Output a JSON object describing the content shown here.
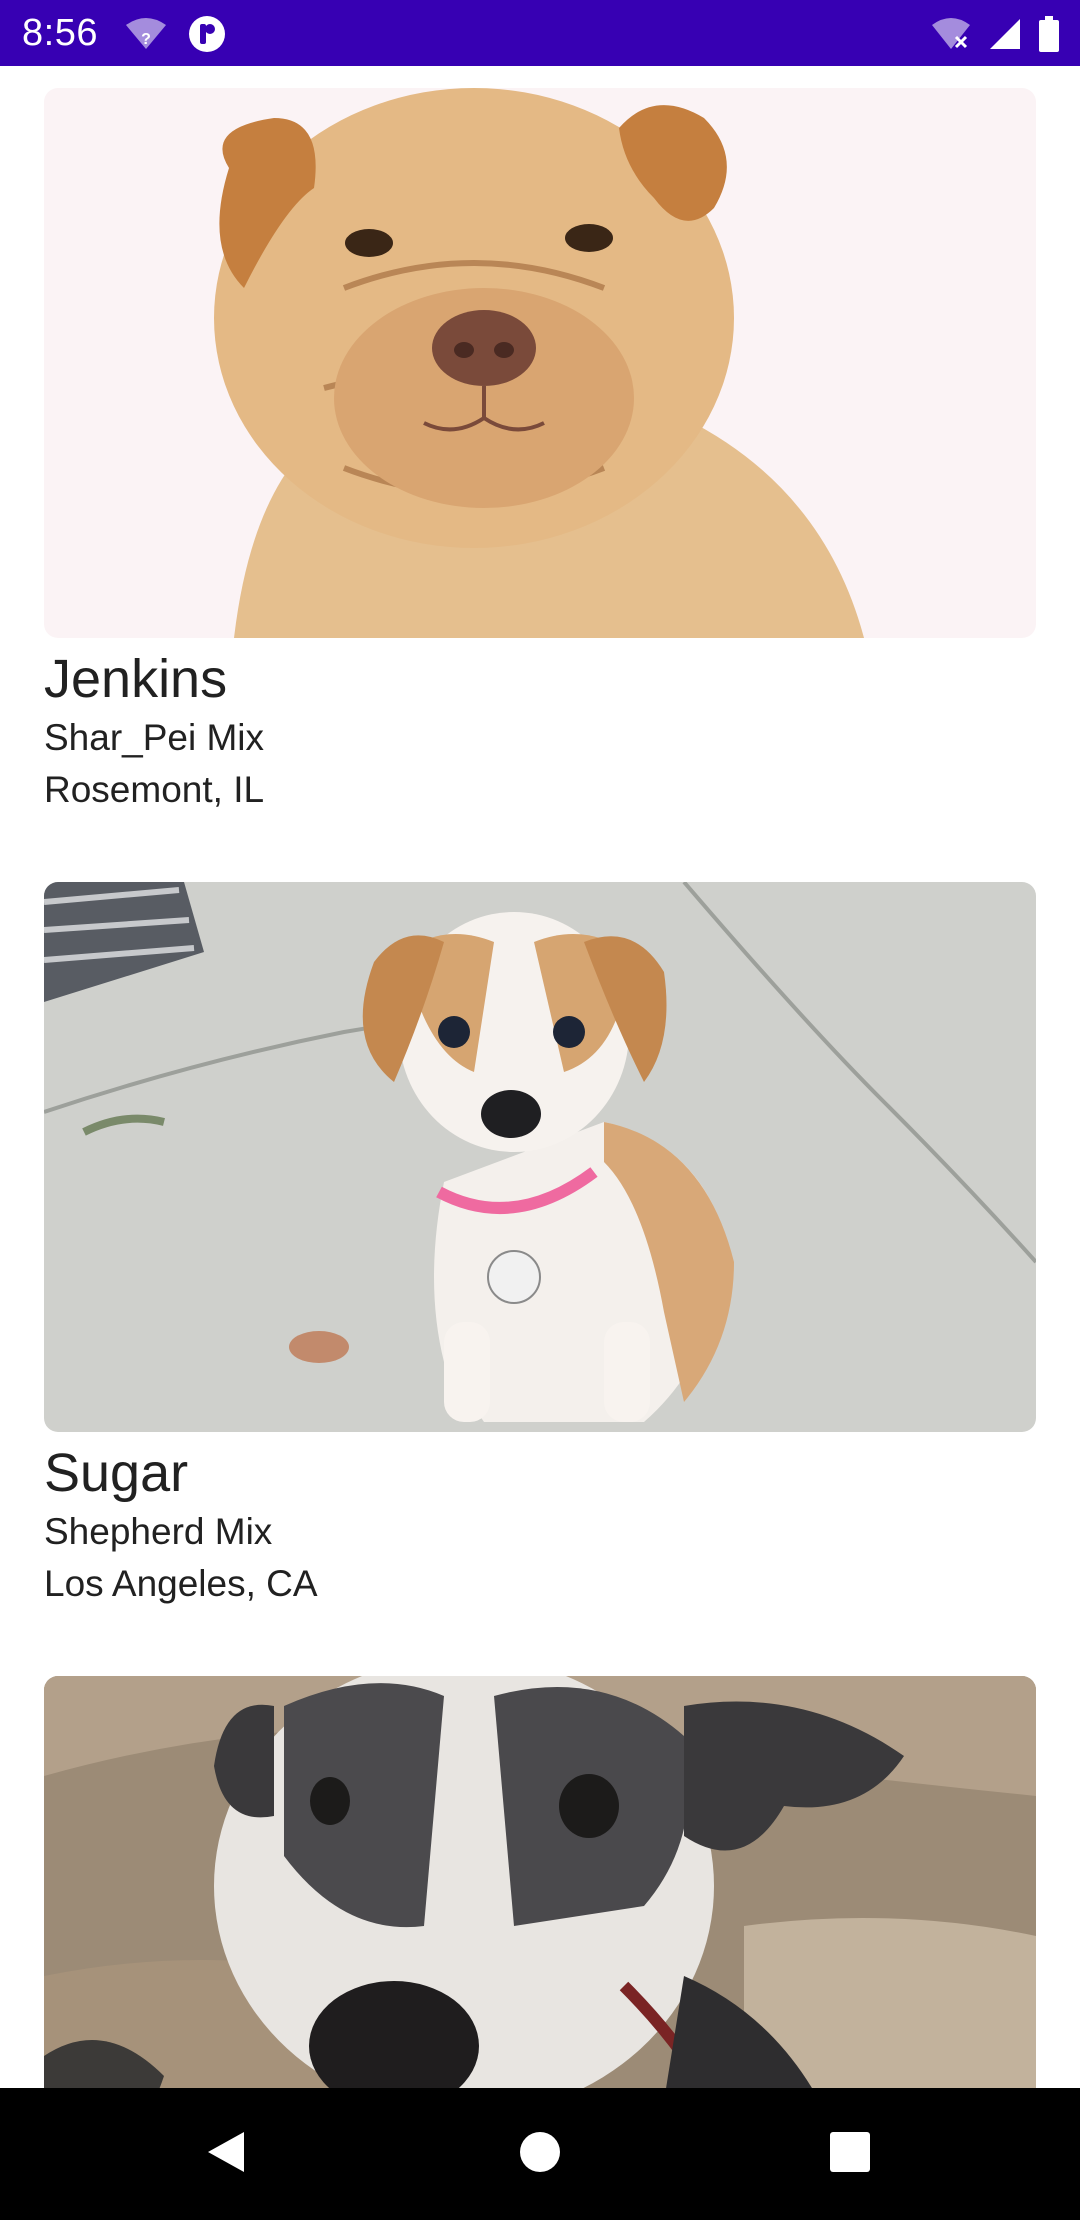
{
  "status_bar": {
    "time": "8:56",
    "icons": [
      "wifi-question-icon",
      "notification-app-icon",
      "wifi-off-icon",
      "cellular-signal-icon",
      "battery-icon"
    ],
    "background": "#3700B3"
  },
  "pets": [
    {
      "name": "Jenkins",
      "breed": "Shar_Pei Mix",
      "location": "Rosemont, IL",
      "photo_description_icon": "shar-pei-puppy-photo"
    },
    {
      "name": "Sugar",
      "breed": "Shepherd Mix",
      "location": "Los Angeles, CA",
      "photo_description_icon": "shepherd-puppy-photo"
    },
    {
      "name": "",
      "breed": "",
      "location": "",
      "photo_description_icon": "senior-dog-photo"
    }
  ],
  "nav_bar": {
    "buttons": [
      "back-icon",
      "home-icon",
      "recents-icon"
    ]
  }
}
